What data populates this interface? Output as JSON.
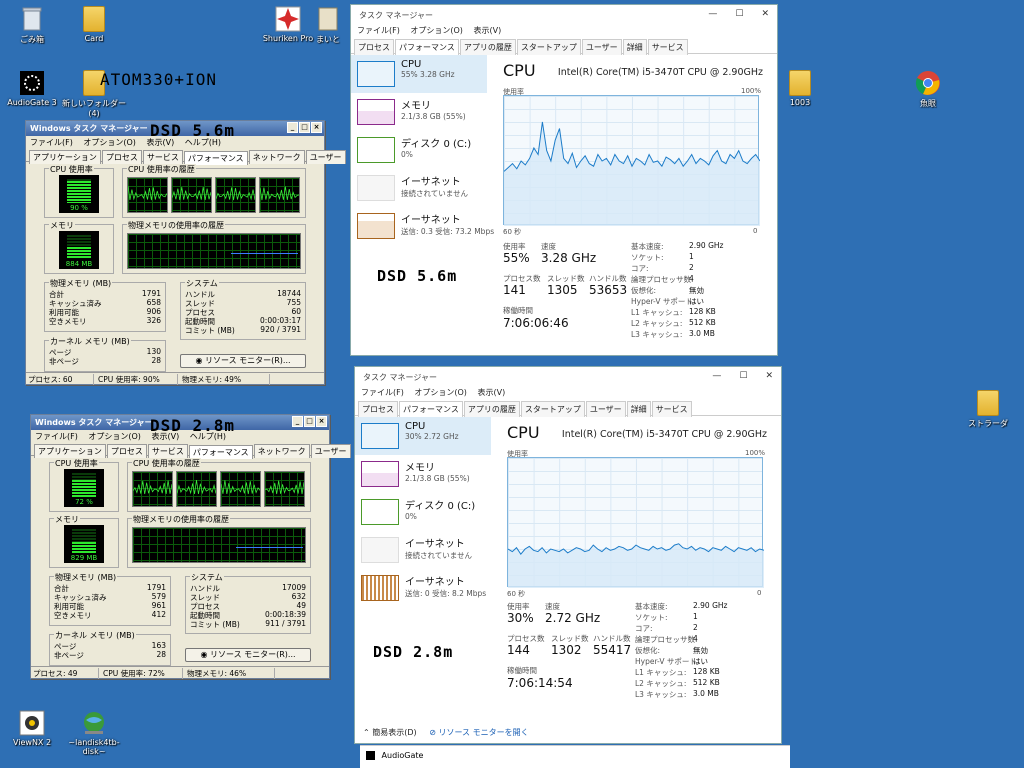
{
  "desktop": {
    "icons": [
      {
        "label": "ごみ箱",
        "icon": "recycle-bin-icon"
      },
      {
        "label": "Card",
        "icon": "folder-icon"
      },
      {
        "label": "Shuriken Pro",
        "icon": "shuriken-pro-icon"
      },
      {
        "label": "まいと",
        "icon": "app-icon"
      },
      {
        "label": "AudioGate 3",
        "icon": "audiogate-icon"
      },
      {
        "label": "新しいフォルダー (4)",
        "icon": "folder-icon"
      },
      {
        "label": "1003",
        "icon": "folder-icon"
      },
      {
        "label": "魚眼",
        "icon": "chrome-icon"
      },
      {
        "label": "ストラーダ",
        "icon": "folder-icon"
      },
      {
        "label": "ViewNX 2",
        "icon": "viewnx-icon"
      },
      {
        "label": "~landisk4tb-disk~",
        "icon": "network-drive-icon"
      }
    ],
    "overlay_texts": [
      "ATOM330+ION",
      "DSD 5.6m",
      "DSD 2.8m",
      "DSD 5.6m",
      "DSD 2.8m"
    ]
  },
  "xp_windows": [
    {
      "title": "Windows タスク マネージャー",
      "menu": [
        "ファイル(F)",
        "オプション(O)",
        "表示(V)",
        "ヘルプ(H)"
      ],
      "tabs": [
        "アプリケーション",
        "プロセス",
        "サービス",
        "パフォーマンス",
        "ネットワーク",
        "ユーザー"
      ],
      "active_tab": 3,
      "cpu_usage_label": "CPU 使用率",
      "cpu_usage_value": "90 %",
      "cpu_usage_fraction": 0.9,
      "cpu_history_label": "CPU 使用率の履歴",
      "memory_label": "メモリ",
      "memory_value": "884 MB",
      "memory_history_label": "物理メモリの使用率の履歴",
      "physical_memory": {
        "heading": "物理メモリ (MB)",
        "rows": [
          [
            "合計",
            "1791"
          ],
          [
            "キャッシュ済み",
            "658"
          ],
          [
            "利用可能",
            "906"
          ],
          [
            "空きメモリ",
            "326"
          ]
        ]
      },
      "kernel_memory": {
        "heading": "カーネル メモリ (MB)",
        "rows": [
          [
            "ページ",
            "130"
          ],
          [
            "非ページ",
            "28"
          ]
        ]
      },
      "system": {
        "heading": "システム",
        "rows": [
          [
            "ハンドル",
            "18744"
          ],
          [
            "スレッド",
            "755"
          ],
          [
            "プロセス",
            "60"
          ],
          [
            "起動時間",
            "0:00:03:17"
          ],
          [
            "コミット (MB)",
            "920 / 3791"
          ]
        ]
      },
      "resource_button": "リソース モニター(R)...",
      "status": [
        "プロセス: 60",
        "CPU 使用率: 90%",
        "物理メモリ: 49%"
      ]
    },
    {
      "title": "Windows タスク マネージャー",
      "menu": [
        "ファイル(F)",
        "オプション(O)",
        "表示(V)",
        "ヘルプ(H)"
      ],
      "tabs": [
        "アプリケーション",
        "プロセス",
        "サービス",
        "パフォーマンス",
        "ネットワーク",
        "ユーザー"
      ],
      "active_tab": 3,
      "cpu_usage_label": "CPU 使用率",
      "cpu_usage_value": "72 %",
      "cpu_usage_fraction": 0.72,
      "cpu_history_label": "CPU 使用率の履歴",
      "memory_label": "メモリ",
      "memory_value": "829 MB",
      "memory_history_label": "物理メモリの使用率の履歴",
      "physical_memory": {
        "heading": "物理メモリ (MB)",
        "rows": [
          [
            "合計",
            "1791"
          ],
          [
            "キャッシュ済み",
            "579"
          ],
          [
            "利用可能",
            "961"
          ],
          [
            "空きメモリ",
            "412"
          ]
        ]
      },
      "kernel_memory": {
        "heading": "カーネル メモリ (MB)",
        "rows": [
          [
            "ページ",
            "163"
          ],
          [
            "非ページ",
            "28"
          ]
        ]
      },
      "system": {
        "heading": "システム",
        "rows": [
          [
            "ハンドル",
            "17009"
          ],
          [
            "スレッド",
            "632"
          ],
          [
            "プロセス",
            "49"
          ],
          [
            "起動時間",
            "0:00:18:39"
          ],
          [
            "コミット (MB)",
            "911 / 3791"
          ]
        ]
      },
      "resource_button": "リソース モニター(R)...",
      "status": [
        "プロセス: 49",
        "CPU 使用率: 72%",
        "物理メモリ: 46%"
      ]
    }
  ],
  "w10_windows": [
    {
      "title": "タスク マネージャー",
      "menu": [
        "ファイル(F)",
        "オプション(O)",
        "表示(V)"
      ],
      "tabs": [
        "プロセス",
        "パフォーマンス",
        "アプリの履歴",
        "スタートアップ",
        "ユーザー",
        "詳細",
        "サービス"
      ],
      "active_tab": 1,
      "side": [
        {
          "name": "CPU",
          "sub": "55%  3.28 GHz"
        },
        {
          "name": "メモリ",
          "sub": "2.1/3.8 GB (55%)"
        },
        {
          "name": "ディスク 0 (C:)",
          "sub": "0%"
        },
        {
          "name": "イーサネット",
          "sub": "接続されていません"
        },
        {
          "name": "イーサネット",
          "sub": "送信: 0.3  受信: 73.2 Mbps"
        }
      ],
      "heading": "CPU",
      "model": "Intel(R) Core(TM) i5-3470T CPU @ 2.90GHz",
      "graph_label": "使用率",
      "graph_max": "100%",
      "graph_time": "60 秒",
      "graph_zero": "0",
      "stats": [
        {
          "label": "使用率",
          "value": "55%"
        },
        {
          "label": "速度",
          "value": "3.28 GHz"
        },
        {
          "label": "プロセス数",
          "value": "141"
        },
        {
          "label": "スレッド数",
          "value": "1305"
        },
        {
          "label": "ハンドル数",
          "value": "53653"
        }
      ],
      "uptime_label": "稼働時間",
      "uptime": "7:06:06:46",
      "specs": [
        [
          "基本速度:",
          "2.90 GHz"
        ],
        [
          "ソケット:",
          "1"
        ],
        [
          "コア:",
          "2"
        ],
        [
          "論理プロセッサ数:",
          "4"
        ],
        [
          "仮想化:",
          "無効"
        ],
        [
          "Hyper-V サポート:",
          "はい"
        ],
        [
          "L1 キャッシュ:",
          "128 KB"
        ],
        [
          "L2 キャッシュ:",
          "512 KB"
        ],
        [
          "L3 キャッシュ:",
          "3.0 MB"
        ]
      ],
      "cpu_series": [
        42,
        45,
        48,
        44,
        50,
        47,
        52,
        60,
        55,
        80,
        58,
        50,
        66,
        75,
        52,
        48,
        56,
        45,
        50,
        54,
        48,
        46,
        55,
        50,
        52,
        47,
        55,
        50,
        48,
        54,
        46,
        52,
        50,
        47,
        55,
        49,
        50,
        46,
        53,
        51,
        48,
        52,
        46,
        50,
        55,
        48,
        52,
        50,
        47,
        54,
        58,
        50,
        48,
        55,
        52,
        58,
        50,
        48,
        52,
        55,
        50
      ]
    },
    {
      "title": "タスク マネージャー",
      "menu": [
        "ファイル(F)",
        "オプション(O)",
        "表示(V)"
      ],
      "tabs": [
        "プロセス",
        "パフォーマンス",
        "アプリの履歴",
        "スタートアップ",
        "ユーザー",
        "詳細",
        "サービス"
      ],
      "active_tab": 1,
      "side": [
        {
          "name": "CPU",
          "sub": "30%  2.72 GHz"
        },
        {
          "name": "メモリ",
          "sub": "2.1/3.8 GB (55%)"
        },
        {
          "name": "ディスク 0 (C:)",
          "sub": "0%"
        },
        {
          "name": "イーサネット",
          "sub": "接続されていません"
        },
        {
          "name": "イーサネット",
          "sub": "送信: 0  受信: 8.2 Mbps"
        }
      ],
      "heading": "CPU",
      "model": "Intel(R) Core(TM) i5-3470T CPU @ 2.90GHz",
      "graph_label": "使用率",
      "graph_max": "100%",
      "graph_time": "60 秒",
      "graph_zero": "0",
      "stats": [
        {
          "label": "使用率",
          "value": "30%"
        },
        {
          "label": "速度",
          "value": "2.72 GHz"
        },
        {
          "label": "プロセス数",
          "value": "144"
        },
        {
          "label": "スレッド数",
          "value": "1302"
        },
        {
          "label": "ハンドル数",
          "value": "55417"
        }
      ],
      "uptime_label": "稼働時間",
      "uptime": "7:06:14:54",
      "specs": [
        [
          "基本速度:",
          "2.90 GHz"
        ],
        [
          "ソケット:",
          "1"
        ],
        [
          "コア:",
          "2"
        ],
        [
          "論理プロセッサ数:",
          "4"
        ],
        [
          "仮想化:",
          "無効"
        ],
        [
          "Hyper-V サポート:",
          "はい"
        ],
        [
          "L1 キャッシュ:",
          "128 KB"
        ],
        [
          "L2 キャッシュ:",
          "512 KB"
        ],
        [
          "L3 キャッシュ:",
          "3.0 MB"
        ]
      ],
      "cpu_series": [
        30,
        28,
        31,
        26,
        30,
        32,
        29,
        28,
        31,
        27,
        30,
        29,
        28,
        30,
        27,
        29,
        31,
        30,
        28,
        29,
        33,
        30,
        28,
        31,
        29,
        30,
        32,
        31,
        29,
        30,
        33,
        31,
        30,
        29,
        32,
        30,
        31,
        29,
        30,
        33,
        34,
        31,
        30,
        32,
        29,
        31,
        30,
        28,
        31,
        30,
        29,
        32,
        30,
        28,
        31,
        30,
        29,
        31,
        28,
        30,
        29
      ],
      "footer_brief": "簡易表示(D)",
      "footer_link": "リソース モニターを開く"
    }
  ],
  "taskbar": {
    "label": "AudioGate"
  },
  "colors": {
    "desktop": "#2e6fb4",
    "w10_cpu_line": "#1c7cc9",
    "w10_cpu_fill": "#d6e9f7",
    "xp_graph_green": "#3cf03c"
  }
}
